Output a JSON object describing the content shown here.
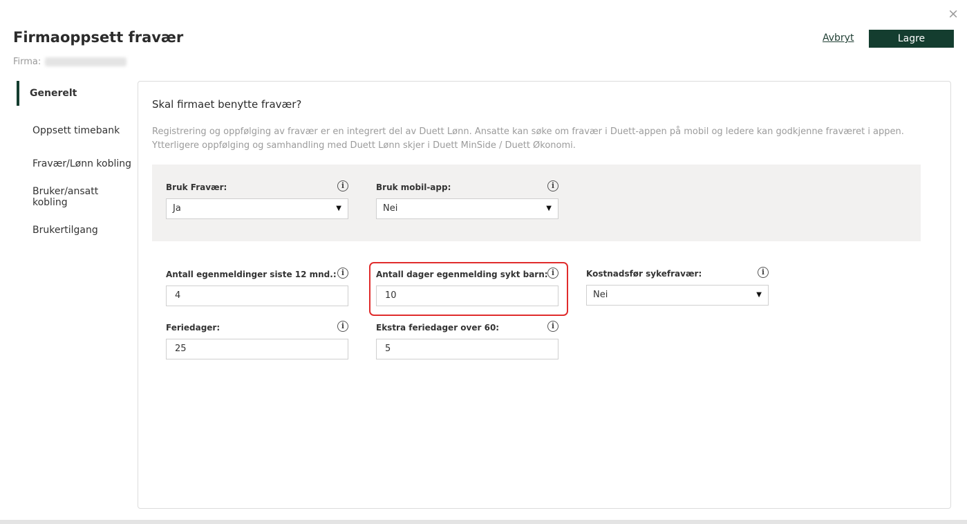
{
  "header": {
    "title": "Firmaoppsett fravær",
    "firma_label": "Firma:",
    "cancel_label": "Avbryt",
    "save_label": "Lagre",
    "close_icon": "×"
  },
  "sidebar": {
    "items": [
      {
        "label": "Generelt",
        "active": true
      },
      {
        "label": "Oppsett timebank"
      },
      {
        "label": "Fravær/Lønn kobling"
      },
      {
        "label": "Bruker/ansatt kobling"
      },
      {
        "label": "Brukertilgang"
      }
    ]
  },
  "panel": {
    "question": "Skal firmaet benytte fravær?",
    "description": "Registrering og oppfølging av fravær er en integrert del av Duett Lønn. Ansatte kan søke om fravær i Duett-appen på mobil og ledere kan godkjenne fraværet i appen. Ytterligere oppfølging og samhandling med Duett Lønn skjer i Duett MinSide / Duett Økonomi."
  },
  "fields": {
    "bruk_fravaer": {
      "label": "Bruk Fravær:",
      "value": "Ja"
    },
    "bruk_mobilapp": {
      "label": "Bruk mobil-app:",
      "value": "Nei"
    },
    "antall_egenmeldinger": {
      "label": "Antall egenmeldinger siste 12 mnd.:",
      "value": "4"
    },
    "antall_dager_sykt_barn": {
      "label": "Antall dager egenmelding sykt barn:",
      "value": "10"
    },
    "kostnadsfor_sykefravaer": {
      "label": "Kostnadsfør sykefravær:",
      "value": "Nei"
    },
    "feriedager": {
      "label": "Feriedager:",
      "value": "25"
    },
    "ekstra_feriedager": {
      "label": "Ekstra feriedager over 60:",
      "value": "5"
    }
  },
  "icons": {
    "info": "i",
    "caret": "▼"
  },
  "colors": {
    "accent": "#143d2f",
    "highlight": "#e02b2b"
  }
}
